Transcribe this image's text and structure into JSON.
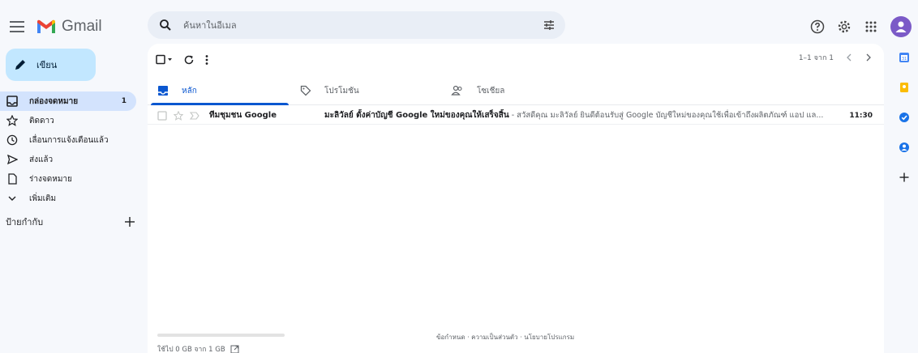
{
  "app": {
    "name": "Gmail"
  },
  "search": {
    "placeholder": "ค้นหาในอีเมล"
  },
  "compose": {
    "label": "เขียน"
  },
  "nav": {
    "items": [
      {
        "label": "กล่องจดหมาย",
        "count": "1",
        "icon": "inbox-icon"
      },
      {
        "label": "ติดดาว",
        "icon": "star-icon"
      },
      {
        "label": "เลื่อนการแจ้งเตือนแล้ว",
        "icon": "clock-icon"
      },
      {
        "label": "ส่งแล้ว",
        "icon": "send-icon"
      },
      {
        "label": "ร่างจดหมาย",
        "icon": "draft-icon"
      },
      {
        "label": "เพิ่มเติม",
        "icon": "chevron-down-icon"
      }
    ],
    "labels_title": "ป้ายกำกับ"
  },
  "pager": {
    "range": "1–1 จาก 1"
  },
  "tabs": [
    {
      "label": "หลัก",
      "icon": "inbox-icon"
    },
    {
      "label": "โปรโมชัน",
      "icon": "tag-icon"
    },
    {
      "label": "โซเชียล",
      "icon": "people-icon"
    }
  ],
  "emails": [
    {
      "sender": "ทีมชุมชน Google",
      "subject": "มะลิวัลย์ ตั้งค่าบัญชี Google ใหม่ของคุณให้เสร็จสิ้น",
      "snippet": " - สวัสดีคุณ มะลิวัลย์ ยินดีต้อนรับสู่ Google บัญชีใหม่ของคุณใช้เพื่อเข้าถึงผลิตภัณฑ์ แอป แล...",
      "time": "11:30"
    }
  ],
  "storage": {
    "text": "ใช้ไป 0 GB จาก 1 GB",
    "used_fraction": 0
  },
  "footer": {
    "text": "ข้อกำหนด · ความเป็นส่วนตัว · นโยบายโปรแกรม"
  },
  "colors": {
    "accent": "#0b57d0",
    "compose_bg": "#c2e7ff",
    "active_nav": "#d3e3fd",
    "page_bg": "#f6f8fc"
  }
}
